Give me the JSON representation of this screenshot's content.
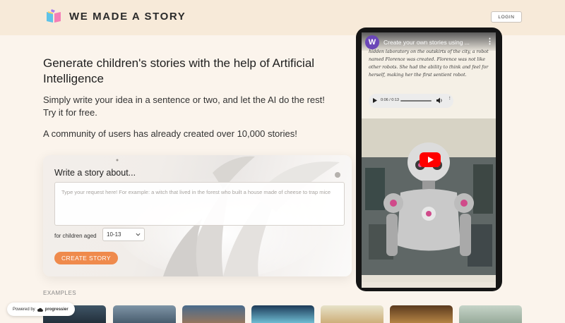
{
  "header": {
    "brand": "WE MADE A STORY",
    "login_label": "LOGIN"
  },
  "hero": {
    "headline": "Generate children's stories with the help of Artificial Intelligence",
    "subtitle": "Simply write your idea in a sentence or two, and let the AI do the rest! Try it for free.",
    "community": "A community of users has already created over 10,000 stories!"
  },
  "form": {
    "title": "Write a story about...",
    "placeholder": "Type your request here! For example: a witch that lived in the forest who built a house made of cheese to trap mice",
    "age_label": "for children aged",
    "age_value": "10-13",
    "submit_label": "CREATE STORY"
  },
  "examples": {
    "label": "EXAMPLES"
  },
  "video": {
    "channel_initial": "W",
    "title": "Create your own stories using ...",
    "story_text": "hidden laboratory on the outskirts of the city, a robot named Florence was created. Florence was not like other robots. She had the ability to think and feel for herself, making her the first sentient robot.",
    "audio_time": "0:06 / 0:13"
  },
  "badge": {
    "prefix": "Powered by",
    "brand": "progressier"
  },
  "colors": {
    "accent": "#ef8a4c",
    "header_bg": "#f7ead9",
    "page_bg": "#fbf4ec"
  }
}
